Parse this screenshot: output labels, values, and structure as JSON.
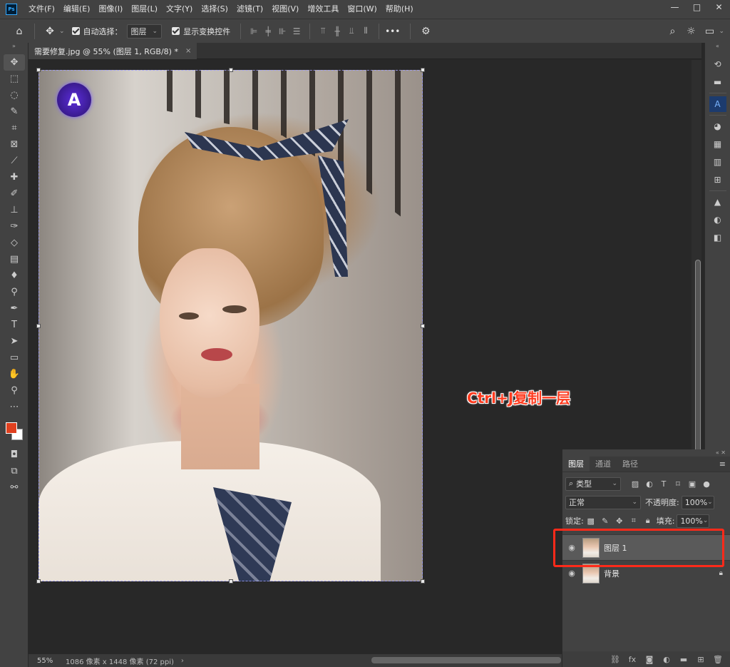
{
  "menubar": {
    "logo": "Ps",
    "items": [
      "文件(F)",
      "编辑(E)",
      "图像(I)",
      "图层(L)",
      "文字(Y)",
      "选择(S)",
      "滤镜(T)",
      "视图(V)",
      "增效工具",
      "窗口(W)",
      "帮助(H)"
    ],
    "minimize": "—",
    "maximize": "□",
    "close": "✕"
  },
  "options": {
    "auto_select_label": "自动选择：",
    "auto_select_value": "图层",
    "show_transform_label": "显示变换控件",
    "more": "•••"
  },
  "document": {
    "tab_title": "需要修复.jpg @ 55% (图层 1, RGB/8) *",
    "tab_close": "×"
  },
  "canvas": {
    "logo_letter": "A",
    "annotation": "Ctrl+J复制一层"
  },
  "status": {
    "zoom": "55%",
    "info": "1086 像素 x 1448 像素 (72 ppi)",
    "arrow": "›"
  },
  "layers_panel": {
    "tabs": [
      "图层",
      "通道",
      "路径"
    ],
    "filter_label": "类型",
    "blend_mode": "正常",
    "opacity_label": "不透明度:",
    "opacity_value": "100%",
    "lock_label": "锁定:",
    "fill_label": "填充:",
    "fill_value": "100%",
    "layers": [
      {
        "name": "图层 1",
        "selected": true
      },
      {
        "name": "背景",
        "selected": false
      }
    ]
  },
  "colors": {
    "foreground": "#e0401f",
    "background": "#ffffff",
    "annotation": "#ff3b1f",
    "highlight_box": "#ff2a1a",
    "ui_panel": "#424242"
  },
  "icons": {
    "home": "home-icon",
    "move": "move-icon",
    "search": "search-icon",
    "sun": "brightness-icon",
    "gear": "gear-icon"
  }
}
